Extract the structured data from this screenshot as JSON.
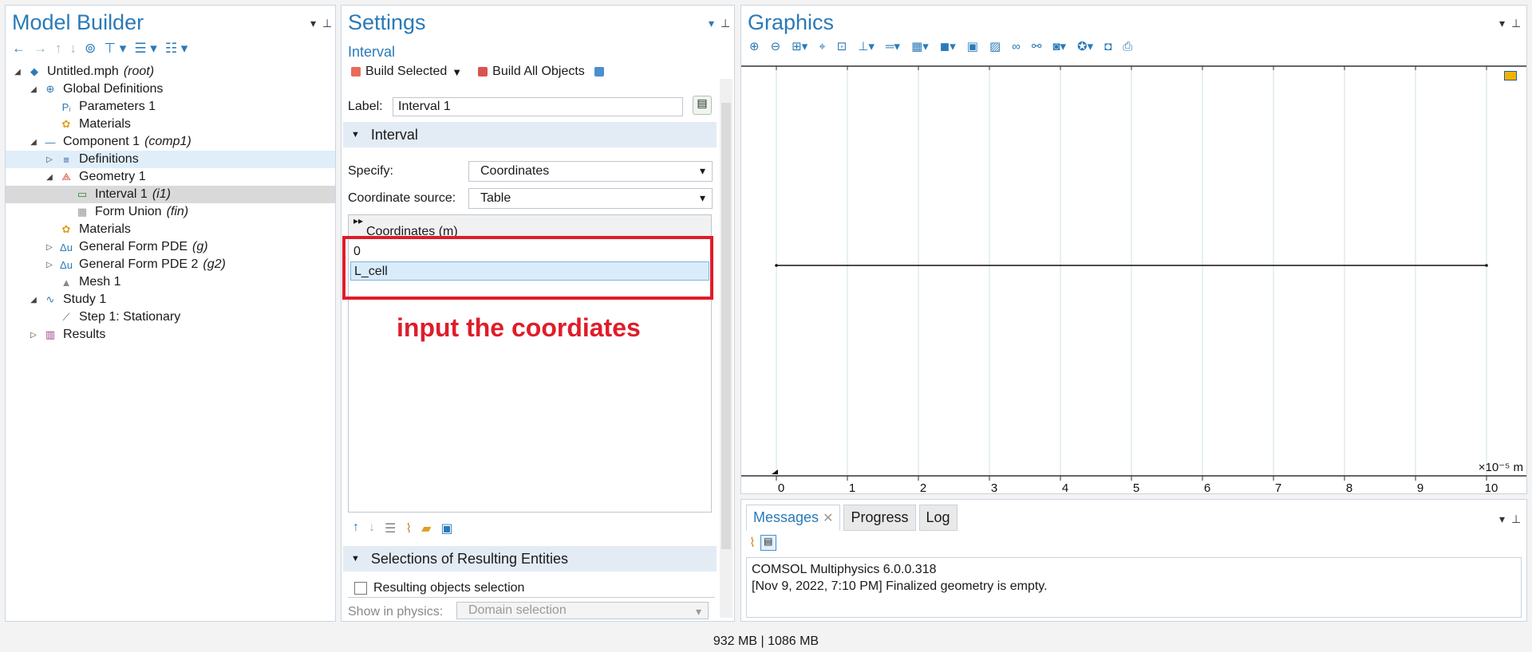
{
  "model_builder": {
    "title": "Model Builder",
    "tree": [
      {
        "label": "Untitled.mph",
        "tag": "(root)",
        "level": 0,
        "expanded": true
      },
      {
        "label": "Global Definitions",
        "tag": "",
        "level": 1,
        "expanded": true
      },
      {
        "label": "Parameters 1",
        "tag": "",
        "level": 2
      },
      {
        "label": "Materials",
        "tag": "",
        "level": 2
      },
      {
        "label": "Component 1",
        "tag": "(comp1)",
        "level": 1,
        "expanded": true
      },
      {
        "label": "Definitions",
        "tag": "",
        "level": 2,
        "collapsed": true
      },
      {
        "label": "Geometry 1",
        "tag": "",
        "level": 2,
        "expanded": true
      },
      {
        "label": "Interval 1",
        "tag": "(i1)",
        "level": 3
      },
      {
        "label": "Form Union",
        "tag": "(fin)",
        "level": 3
      },
      {
        "label": "Materials",
        "tag": "",
        "level": 2
      },
      {
        "label": "General Form PDE",
        "tag": "(g)",
        "level": 2,
        "collapsed": true
      },
      {
        "label": "General Form PDE 2",
        "tag": "(g2)",
        "level": 2,
        "collapsed": true
      },
      {
        "label": "Mesh 1",
        "tag": "",
        "level": 2
      },
      {
        "label": "Study 1",
        "tag": "",
        "level": 1,
        "expanded": true
      },
      {
        "label": "Step 1: Stationary",
        "tag": "",
        "level": 2
      },
      {
        "label": "Results",
        "tag": "",
        "level": 1,
        "collapsed": true
      }
    ]
  },
  "settings": {
    "title": "Settings",
    "subtitle": "Interval",
    "build_selected": "Build Selected",
    "build_all": "Build All Objects",
    "label_caption": "Label:",
    "label_value": "Interval 1",
    "section_interval": "Interval",
    "specify_caption": "Specify:",
    "specify_value": "Coordinates",
    "coord_source_caption": "Coordinate source:",
    "coord_source_value": "Table",
    "table_header": "Coordinates (m)",
    "rows": [
      "0",
      "L_cell"
    ],
    "annotation": "input the coordiates",
    "section_selections": "Selections of Resulting Entities",
    "resulting_objects": "Resulting objects selection",
    "show_in_physics_caption": "Show in physics:",
    "show_in_physics_value": "Domain selection"
  },
  "graphics": {
    "title": "Graphics",
    "axis_ticks": [
      "0",
      "1",
      "2",
      "3",
      "4",
      "5",
      "6",
      "7",
      "8",
      "9",
      "10"
    ],
    "axis_scale": "×10⁻⁵ m"
  },
  "messages": {
    "tabs": [
      "Messages",
      "Progress",
      "Log"
    ],
    "lines": [
      "COMSOL Multiphysics 6.0.0.318",
      "[Nov 9, 2022, 7:10 PM] Finalized geometry is empty."
    ]
  },
  "status": "932 MB | 1086 MB",
  "colors": {
    "accent": "#2a7ab8",
    "annotation": "#e01c2a"
  }
}
